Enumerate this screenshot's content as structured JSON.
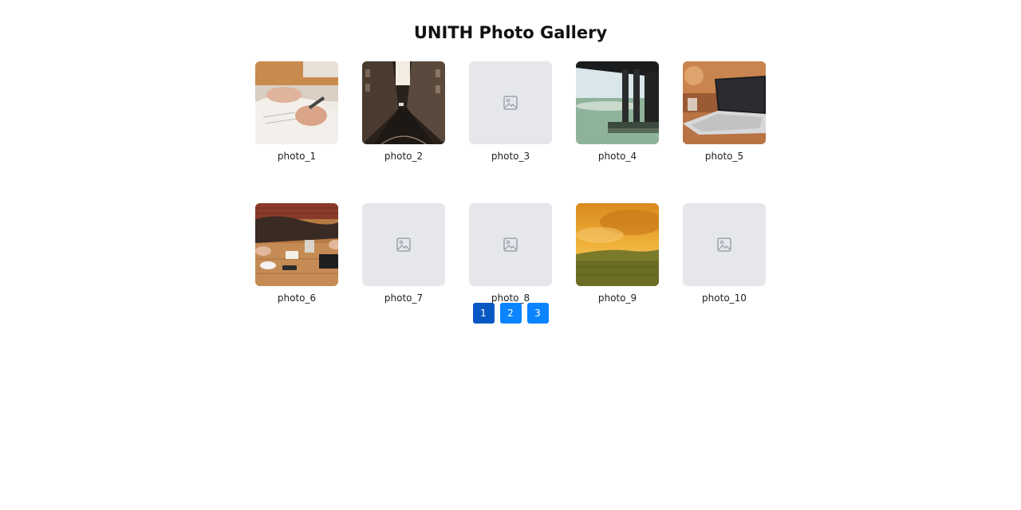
{
  "title": "UNITH Photo Gallery",
  "photos": [
    {
      "caption": "photo_1",
      "state": "loaded",
      "scene": "hands-writing"
    },
    {
      "caption": "photo_2",
      "state": "loaded",
      "scene": "city-street-sepia"
    },
    {
      "caption": "photo_3",
      "state": "placeholder",
      "scene": ""
    },
    {
      "caption": "photo_4",
      "state": "loaded",
      "scene": "pier-over-water"
    },
    {
      "caption": "photo_5",
      "state": "loaded",
      "scene": "laptop-on-desk"
    },
    {
      "caption": "photo_6",
      "state": "loaded",
      "scene": "table-with-coffee"
    },
    {
      "caption": "photo_7",
      "state": "placeholder",
      "scene": ""
    },
    {
      "caption": "photo_8",
      "state": "placeholder",
      "scene": ""
    },
    {
      "caption": "photo_9",
      "state": "loaded",
      "scene": "golden-field-sky"
    },
    {
      "caption": "photo_10",
      "state": "placeholder",
      "scene": ""
    }
  ],
  "pagination": {
    "pages": [
      "1",
      "2",
      "3"
    ],
    "current": "1"
  },
  "colors": {
    "accent": "#0a84ff",
    "accent_active": "#0858c4",
    "placeholder_bg": "#e5e7eb",
    "placeholder_icon": "#9ca3af"
  },
  "icons": {
    "placeholder": "image-placeholder-icon"
  }
}
